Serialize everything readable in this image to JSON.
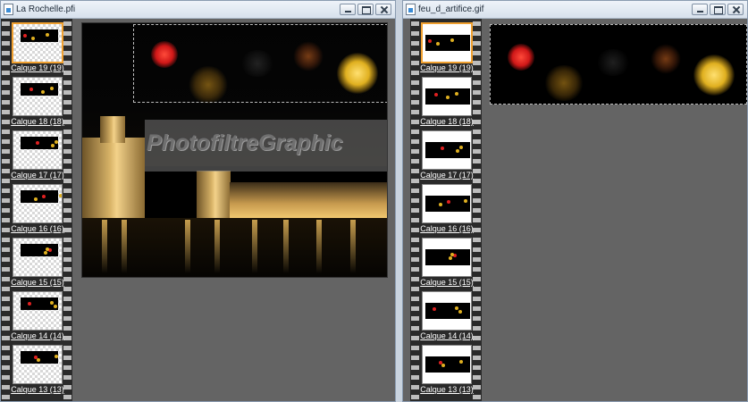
{
  "windows": [
    {
      "title": "La Rochelle.pfi",
      "thumb_style": "checker",
      "frames": [
        "Calque 19 (19)",
        "Calque 18 (18)",
        "Calque 17 (17)",
        "Calque 16 (16)",
        "Calque 15 (15)",
        "Calque 14 (14)",
        "Calque 13 (13)"
      ],
      "selected_index": 0,
      "watermark_text": "PhotofiltreGraphic"
    },
    {
      "title": "feu_d_artifice.gif",
      "thumb_style": "white",
      "frames": [
        "Calque 19 (19)",
        "Calque 18 (18)",
        "Calque 17 (17)",
        "Calque 16 (16)",
        "Calque 15 (15)",
        "Calque 14 (14)",
        "Calque 13 (13)"
      ],
      "selected_index": 0
    }
  ],
  "icons": {
    "app": "document-icon",
    "minimize": "minimize-icon",
    "maximize": "maximize-icon",
    "close": "close-icon"
  },
  "colors": {
    "selection_outline": "#f0a030",
    "firework_red": "#e02020",
    "firework_gold": "#e0b020"
  }
}
